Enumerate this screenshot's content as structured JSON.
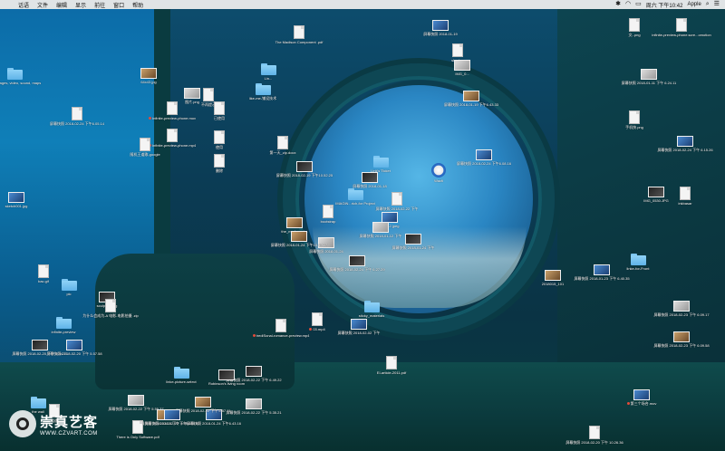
{
  "menubar": {
    "apple": "",
    "items": [
      "话语",
      "文件",
      "编辑",
      "显示",
      "前往",
      "窗口",
      "帮助"
    ],
    "status": {
      "datetime": "周六 下午10:42",
      "user": "Apple"
    }
  },
  "desktop_items": [
    {
      "label": "text, images, video, sound, maps",
      "kind": "folder"
    },
    {
      "label": "屏幕快照 2018-02-24 下午6.05.14",
      "kind": "doc"
    },
    {
      "label": "64x43.jpg",
      "kind": "thumb"
    },
    {
      "label": "Infinite-preview-phone.mov",
      "kind": "doc"
    },
    {
      "label": "Infinite-preview-phone.mp4",
      "kind": "doc"
    },
    {
      "label": "图片.png",
      "kind": "thumb"
    },
    {
      "label": "不再提示",
      "kind": "doc"
    },
    {
      "label": "已使用",
      "kind": "doc"
    },
    {
      "label": "使用",
      "kind": "doc"
    },
    {
      "label": "删除",
      "kind": "doc"
    },
    {
      "label": "随机王道歌-google",
      "kind": "doc"
    },
    {
      "label": "sketch001.jpg",
      "kind": "thumb"
    },
    {
      "label": "The Madison Component .pdf",
      "kind": "doc"
    },
    {
      "label": "Lin...",
      "kind": "folder"
    },
    {
      "label": "like-me-铺设技术",
      "kind": "folder"
    },
    {
      "label": "屏幕快照 2018-01-19",
      "kind": "thumb"
    },
    {
      "label": "shadow",
      "kind": "doc"
    },
    {
      "label": "IMG_0...",
      "kind": "thumb"
    },
    {
      "label": "屏幕快照 2018-01-19 下午6.43.33",
      "kind": "thumb"
    },
    {
      "label": "第一天_zip.docx",
      "kind": "doc"
    },
    {
      "label": "屏幕快照 2018-02-19 下午10.52.25",
      "kind": "thumb"
    },
    {
      "label": "Link's Ticket",
      "kind": "folder"
    },
    {
      "label": "Wacfi",
      "kind": "quicktime"
    },
    {
      "label": "屏幕快照 2018-02-24 下午6.08.16",
      "kind": "thumb"
    },
    {
      "label": "屏幕快照 2018-01-18",
      "kind": "thumb"
    },
    {
      "label": "IMAGIN...rich-for Project",
      "kind": "folder"
    },
    {
      "label": "the_mudguard...",
      "kind": "thumb"
    },
    {
      "label": "img-12.jpeg",
      "kind": "thumb"
    },
    {
      "label": "屏幕快照 2018-01-24 下午",
      "kind": "thumb"
    },
    {
      "label": "屏幕快照 2018-01-24",
      "kind": "thumb"
    },
    {
      "label": "屏幕快照 2018-01-24 下午10.49.27",
      "kind": "thumb"
    },
    {
      "label": "bootstrap",
      "kind": "doc"
    },
    {
      "label": "屏幕快照 2018-02-22 下午",
      "kind": "doc"
    },
    {
      "label": "屏幕快照 2018-01-12 下午",
      "kind": "thumb"
    },
    {
      "label": "bac.gif",
      "kind": "doc"
    },
    {
      "label": "pic",
      "kind": "folder"
    },
    {
      "label": "sculpture.jpg",
      "kind": "thumb"
    },
    {
      "label": "infinite-preview",
      "kind": "folder"
    },
    {
      "label": "为什么会成为-A 电影-电影拍摄 .zip",
      "kind": "doc"
    },
    {
      "label": "屏幕快照 2018-02-20 下午 5.57.58",
      "kind": "thumb"
    },
    {
      "label": "屏幕快照 2018-02-20 下午 5.44.17",
      "kind": "thumb"
    },
    {
      "label": "屏幕快照 2018-02-22 下午 5.55.37",
      "kind": "thumb"
    },
    {
      "label": "屏幕快照 2018-02-20 下午 6.55.52",
      "kind": "thumb"
    },
    {
      "label": "屏幕快照 2018-01-24 下午6.43.16",
      "kind": "thumb"
    },
    {
      "label": "屏幕快照 2018-02-22 下午 6.49.22",
      "kind": "thumb"
    },
    {
      "label": "trediSonal-romance-preview.mp4",
      "kind": "doc"
    },
    {
      "label": "03.mp4",
      "kind": "doc"
    },
    {
      "label": "屏幕快照 2018-02-02 下午",
      "kind": "thumb"
    },
    {
      "label": "屏幕快照 2018-02-24 下午 6.27.29",
      "kind": "thumb"
    },
    {
      "label": "sticky_materials",
      "kind": "folder"
    },
    {
      "label": "EI-article-2011.pdf",
      "kind": "doc"
    },
    {
      "label": "linke-picture-select",
      "kind": "folder"
    },
    {
      "label": "Robinson's living room",
      "kind": "thumb"
    },
    {
      "label": "屏幕快照 2018-02-22 下午 5.35.21",
      "kind": "thumb"
    },
    {
      "label": "屏幕快照 2018-02-22 下午 5.57.11",
      "kind": "thumb"
    },
    {
      "label": "屏幕快照 2018-02-22 下午 6.55.52",
      "kind": "thumb"
    },
    {
      "label": "There is Only Software.pdf",
      "kind": "doc"
    },
    {
      "label": "the wall",
      "kind": "folder"
    },
    {
      "label": "相遇",
      "kind": "doc"
    },
    {
      "label": "文-.png",
      "kind": "doc"
    },
    {
      "label": "infinite-preview-phone.scre...omotion",
      "kind": "doc"
    },
    {
      "label": "屏幕快照 2018-01-11 下午 6.24.11",
      "kind": "thumb"
    },
    {
      "label": "手机快.png",
      "kind": "doc"
    },
    {
      "label": "屏幕快照 2018-02-24 下午 6.15.26",
      "kind": "thumb"
    },
    {
      "label": "IMG_0530.JPG",
      "kind": "thumb"
    },
    {
      "label": "inkbasar",
      "kind": "doc"
    },
    {
      "label": "2018015_101",
      "kind": "thumb"
    },
    {
      "label": "屏幕快照 2018-01-23 下午 6.40.35",
      "kind": "thumb"
    },
    {
      "label": "linke-for-Front",
      "kind": "folder"
    },
    {
      "label": "屏幕快照 2018-02-23 下午 6.09.17",
      "kind": "thumb"
    },
    {
      "label": "屏幕快照 2018-02-23 下午 6.09.58",
      "kind": "thumb"
    },
    {
      "label": "第三个场合.mov",
      "kind": "thumb"
    },
    {
      "label": "屏幕快照 2018-02-20 下午 10.26.36",
      "kind": "doc"
    }
  ],
  "watermark": {
    "cn": "崇真艺客",
    "en": "WWW.CZVART.COM"
  },
  "colors": {
    "menubar": "#ececec",
    "folder": "#6cbcef",
    "recording_dot": "#e14b3a"
  }
}
